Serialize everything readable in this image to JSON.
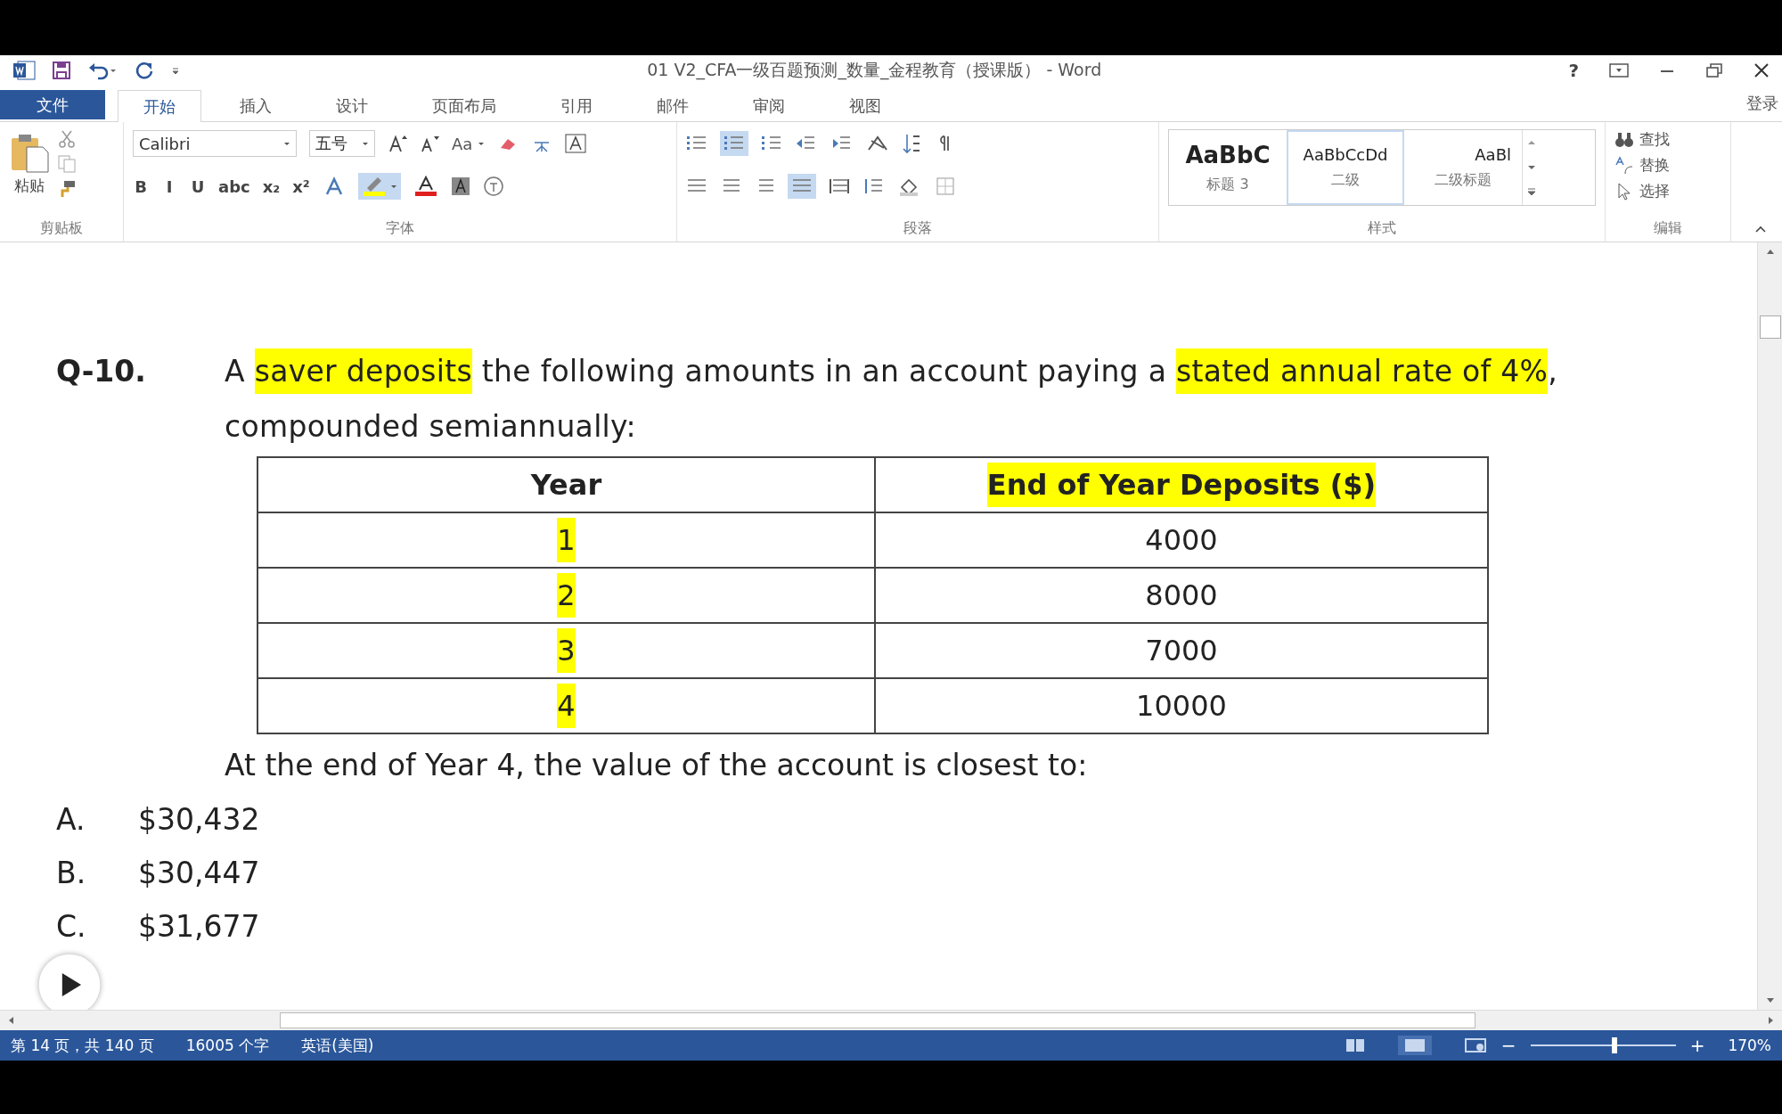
{
  "window": {
    "title": "01 V2_CFA一级百题预测_数量_金程教育（授课版） - Word",
    "help": "?",
    "login": "登录"
  },
  "tabs": [
    {
      "label": "文件",
      "kind": "file",
      "selected": false
    },
    {
      "label": "开始",
      "kind": "tab",
      "selected": true
    },
    {
      "label": "插入",
      "kind": "tab",
      "selected": false
    },
    {
      "label": "设计",
      "kind": "tab",
      "selected": false
    },
    {
      "label": "页面布局",
      "kind": "tab",
      "selected": false
    },
    {
      "label": "引用",
      "kind": "tab",
      "selected": false
    },
    {
      "label": "邮件",
      "kind": "tab",
      "selected": false
    },
    {
      "label": "审阅",
      "kind": "tab",
      "selected": false
    },
    {
      "label": "视图",
      "kind": "tab",
      "selected": false
    }
  ],
  "ribbon": {
    "clipboard": {
      "paste": "粘贴",
      "label": "剪贴板"
    },
    "font": {
      "name": "Calibri",
      "size": "五号",
      "case": "Aa",
      "format_buttons": [
        "B",
        "I",
        "U",
        "abc",
        "x₂",
        "x²"
      ],
      "label": "字体"
    },
    "paragraph": {
      "label": "段落"
    },
    "styles": {
      "items": [
        {
          "preview": "AaBbC",
          "name": "标题 3",
          "selected": false
        },
        {
          "preview": "AaBbCcDd",
          "name": "二级",
          "selected": true
        },
        {
          "preview": "AaBl",
          "name": "二级标题",
          "selected": false
        }
      ],
      "label": "样式"
    },
    "editing": {
      "items": [
        "查找",
        "替换",
        "选择"
      ],
      "label": "编辑"
    }
  },
  "document": {
    "question": {
      "number": "Q-10.",
      "segments": [
        {
          "text": "A ",
          "highlight": false
        },
        {
          "text": "saver deposits",
          "highlight": true
        },
        {
          "text": " the following amounts in an account paying a ",
          "highlight": false
        },
        {
          "text": "stated annual rate of 4%",
          "highlight": true
        },
        {
          "text": ", compounded semiannually:",
          "highlight": false
        }
      ]
    },
    "table": {
      "columns": [
        {
          "text": "Year",
          "highlight": false
        },
        {
          "text": "End of Year Deposits ($)",
          "highlight": true
        }
      ],
      "rows": [
        [
          {
            "text": "1",
            "highlight": true
          },
          {
            "text": "4000",
            "highlight": false
          }
        ],
        [
          {
            "text": "2",
            "highlight": true
          },
          {
            "text": "8000",
            "highlight": false
          }
        ],
        [
          {
            "text": "3",
            "highlight": true
          },
          {
            "text": "7000",
            "highlight": false
          }
        ],
        [
          {
            "text": "4",
            "highlight": true
          },
          {
            "text": "10000",
            "highlight": false
          }
        ]
      ]
    },
    "prompt": "At the end of Year 4, the value of the account is closest to:",
    "options": [
      {
        "letter": "A.",
        "text": "$30,432"
      },
      {
        "letter": "B.",
        "text": "$30,447"
      },
      {
        "letter": "C.",
        "text": "$31,677"
      }
    ]
  },
  "status_bar": {
    "page": "第 14 页，共 140 页",
    "words": "16005 个字",
    "language": "英语(美国)",
    "zoom_out": "−",
    "zoom_slider": {
      "level": 0.58
    },
    "zoom_in": "+",
    "zoom": "170%"
  }
}
